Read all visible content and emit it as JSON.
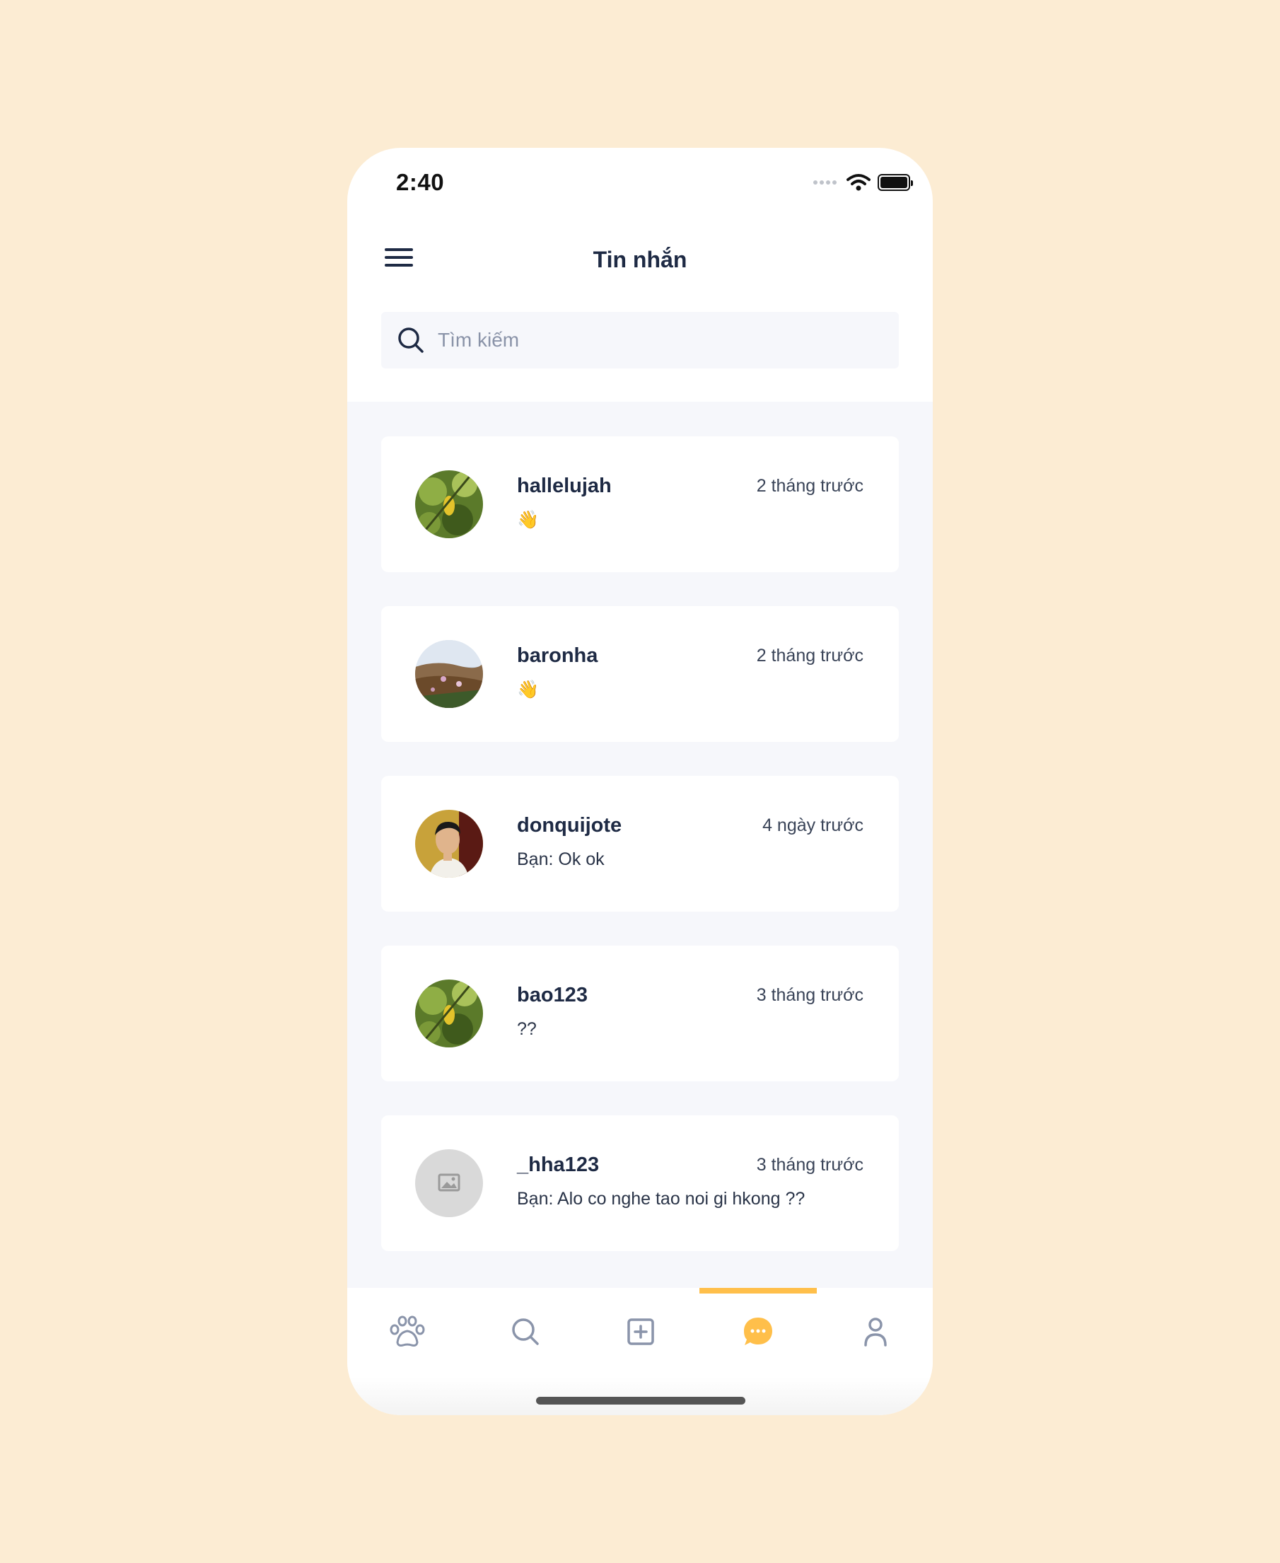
{
  "status_bar": {
    "time": "2:40"
  },
  "header": {
    "title": "Tin nhắn"
  },
  "search": {
    "placeholder": "Tìm kiếm"
  },
  "conversations": [
    {
      "name": "hallelujah",
      "time": "2 tháng trước",
      "last_message": "👋",
      "avatar": "leaves-photo"
    },
    {
      "name": "baronha",
      "time": "2 tháng trước",
      "last_message": "👋",
      "avatar": "field-photo"
    },
    {
      "name": "donquijote",
      "time": "4 ngày trước",
      "last_message": "Bạn: Ok ok",
      "avatar": "person-photo"
    },
    {
      "name": "bao123",
      "time": "3 tháng trước",
      "last_message": "??",
      "avatar": "leaves-photo"
    },
    {
      "name": "_hha123",
      "time": "3 tháng trước",
      "last_message": "Bạn: Alo co nghe tao noi gi hkong ??",
      "avatar": "image-placeholder-icon"
    }
  ],
  "bottom_nav": {
    "items": [
      "paw-icon",
      "search-icon",
      "add-post-icon",
      "chat-icon",
      "profile-icon"
    ],
    "active": "chat-icon"
  },
  "colors": {
    "background": "#fcecd3",
    "accent": "#ffbf4a",
    "text": "#1e2a44",
    "list_bg": "#f6f7fb"
  }
}
